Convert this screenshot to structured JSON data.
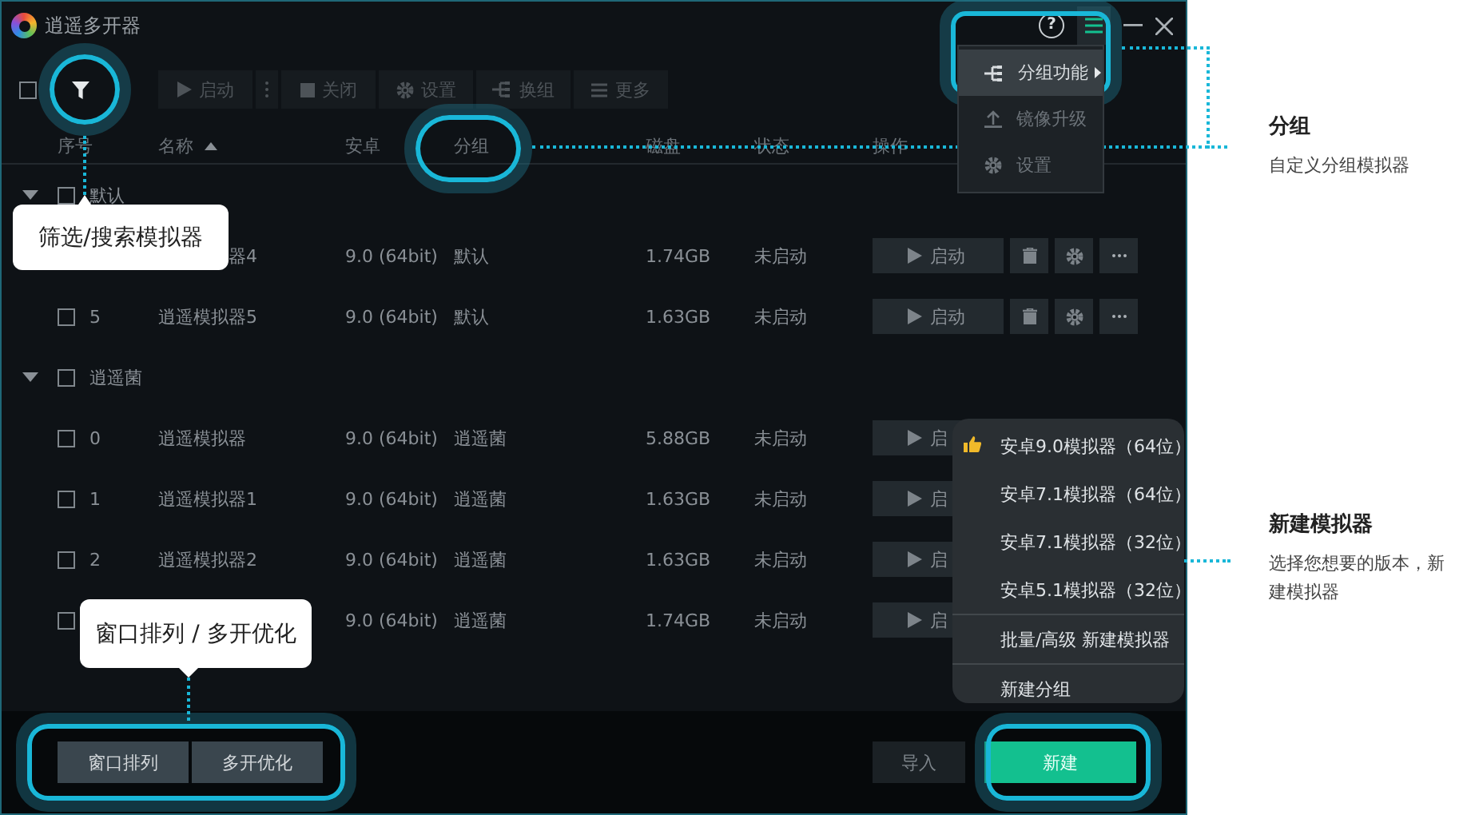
{
  "window": {
    "title": "逍遥多开器",
    "help": "?"
  },
  "main_menu": {
    "items": [
      {
        "label": "分组功能",
        "selected": true,
        "submenu": true
      },
      {
        "label": "镜像升级",
        "selected": false,
        "submenu": false
      },
      {
        "label": "设置",
        "selected": false,
        "submenu": false
      }
    ]
  },
  "toolbar": {
    "select_all_checked": false,
    "buttons": [
      {
        "label": "启动",
        "disabled": true
      },
      {
        "label": "关闭",
        "disabled": true
      },
      {
        "label": "设置",
        "disabled": true
      },
      {
        "label": "换组",
        "disabled": true
      },
      {
        "label": "更多",
        "disabled": true
      }
    ]
  },
  "table": {
    "columns": [
      {
        "label": "序号",
        "sorted": false
      },
      {
        "label": "名称",
        "sorted": true
      },
      {
        "label": "安卓",
        "sorted": false
      },
      {
        "label": "分组",
        "sorted": false
      },
      {
        "label": "磁盘",
        "sorted": false
      },
      {
        "label": "状态",
        "sorted": false
      },
      {
        "label": "操作",
        "sorted": false
      }
    ],
    "groups": [
      {
        "name": "默认",
        "expanded": true,
        "checked": false,
        "rows": [
          {
            "covered": true,
            "name": "器4",
            "android": "9.0 (64bit)",
            "group": "默认",
            "disk": "1.74GB",
            "status": "未启动",
            "start_label": "启动"
          },
          {
            "covered": false,
            "index": "5",
            "name": "逍遥模拟器5",
            "android": "9.0 (64bit)",
            "group": "默认",
            "disk": "1.63GB",
            "status": "未启动",
            "start_label": "启动",
            "checked": false
          }
        ]
      },
      {
        "name": "逍遥菌",
        "expanded": true,
        "checked": false,
        "rows": [
          {
            "covered": false,
            "index": "0",
            "name": "逍遥模拟器",
            "android": "9.0 (64bit)",
            "group": "逍遥菌",
            "disk": "5.88GB",
            "status": "未启动",
            "start_label": "启",
            "checked": false
          },
          {
            "covered": false,
            "index": "1",
            "name": "逍遥模拟器1",
            "android": "9.0 (64bit)",
            "group": "逍遥菌",
            "disk": "1.63GB",
            "status": "未启动",
            "start_label": "启",
            "checked": false
          },
          {
            "covered": false,
            "index": "2",
            "name": "逍遥模拟器2",
            "android": "9.0 (64bit)",
            "group": "逍遥菌",
            "disk": "1.63GB",
            "status": "未启动",
            "start_label": "启",
            "checked": false
          },
          {
            "covered": true,
            "android": "9.0 (64bit)",
            "group": "逍遥菌",
            "disk": "1.74GB",
            "status": "未启动",
            "start_label": "启",
            "checked": false
          }
        ]
      }
    ]
  },
  "new_menu": {
    "items": [
      {
        "label": "安卓9.0模拟器（64位）",
        "recommended": true,
        "divider_before": false
      },
      {
        "label": "安卓7.1模拟器（64位）",
        "recommended": false,
        "divider_before": false
      },
      {
        "label": "安卓7.1模拟器（32位）",
        "recommended": false,
        "divider_before": false
      },
      {
        "label": "安卓5.1模拟器（32位）",
        "recommended": false,
        "divider_before": false
      },
      {
        "label": "批量/高级 新建模拟器",
        "recommended": false,
        "divider_before": true
      },
      {
        "label": "新建分组",
        "recommended": false,
        "divider_before": true
      }
    ]
  },
  "footer": {
    "left_buttons": [
      "窗口排列",
      "多开优化"
    ],
    "import": "导入",
    "create": "新建"
  },
  "callouts": [
    {
      "text": "筛选/搜索模拟器"
    },
    {
      "text": "窗口排列 / 多开优化"
    }
  ],
  "notes": [
    {
      "title": "分组",
      "text": "自定义分组模拟器"
    },
    {
      "title": "新建模拟器",
      "text": "选择您想要的版本，新建模拟器"
    }
  ]
}
